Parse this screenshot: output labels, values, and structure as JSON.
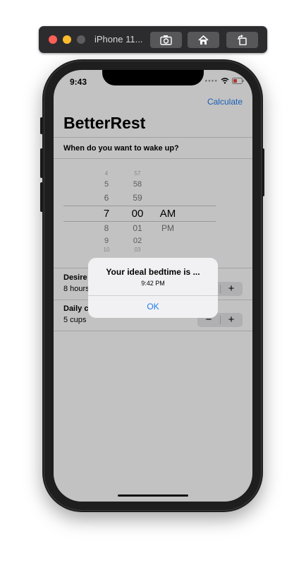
{
  "simulator": {
    "title": "iPhone 11..."
  },
  "status_bar": {
    "time": "9:43"
  },
  "nav": {
    "calculate_label": "Calculate"
  },
  "app": {
    "title": "BetterRest"
  },
  "wake_section": {
    "label": "When do you want to wake up?"
  },
  "picker": {
    "hours_above": [
      "4",
      "5",
      "6"
    ],
    "hour_selected": "7",
    "hours_below": [
      "8",
      "9",
      "10"
    ],
    "minutes_above": [
      "57",
      "58",
      "59"
    ],
    "minute_selected": "00",
    "minutes_below": [
      "01",
      "02",
      "03"
    ],
    "period_selected": "AM",
    "period_below": "PM"
  },
  "sleep_section": {
    "label": "Desire",
    "value": "8 hours"
  },
  "coffee_section": {
    "label": "Daily c",
    "value": "5 cups"
  },
  "stepper": {
    "minus": "−",
    "plus": "+"
  },
  "alert": {
    "title": "Your ideal bedtime is ...",
    "message": "9:42 PM",
    "ok_label": "OK"
  },
  "colors": {
    "accent": "#1e7bf1",
    "dim_overlay": "rgba(0,0,0,0.24)"
  }
}
